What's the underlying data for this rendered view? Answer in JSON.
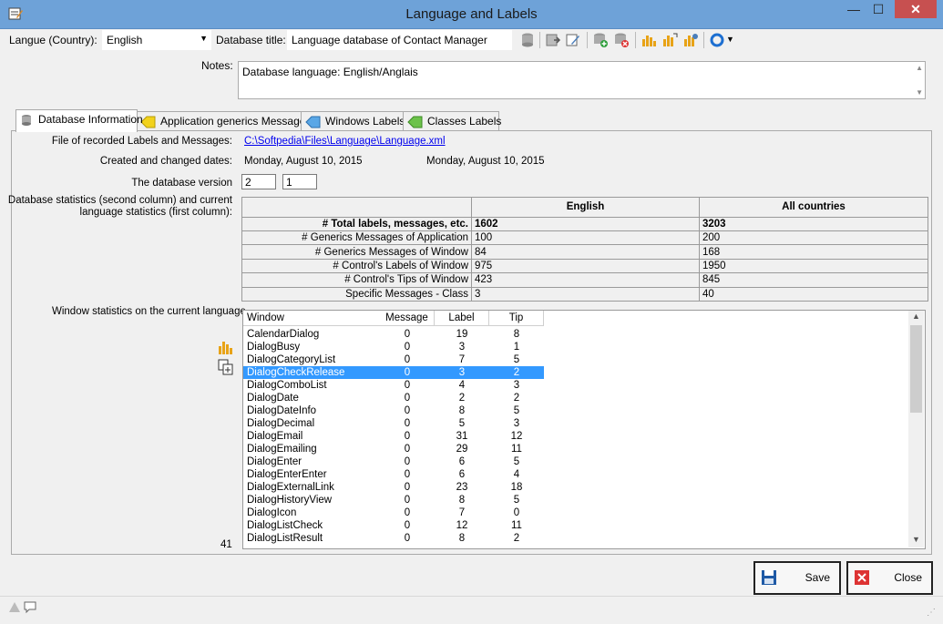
{
  "window": {
    "title": "Language and Labels",
    "min": "—",
    "max": "☐",
    "close": "✕"
  },
  "topbar": {
    "language_label": "Langue (Country):",
    "language_value": "English",
    "db_title_label": "Database title:",
    "db_title_value": "Language database of Contact Manager"
  },
  "notes": {
    "label": "Notes:",
    "value": "Database language: English/Anglais"
  },
  "tabs": [
    {
      "label": "Database Information"
    },
    {
      "label": "Application generics Messages"
    },
    {
      "label": "Windows Labels"
    },
    {
      "label": "Classes Labels"
    }
  ],
  "info": {
    "file_label": "File of recorded Labels and Messages:",
    "file_value": "C:\\Softpedia\\Files\\Language\\Language.xml",
    "dates_label": "Created and changed dates:",
    "created": "Monday, August 10, 2015",
    "changed": "Monday, August 10, 2015",
    "version_label": "The database version",
    "version_major": "2",
    "version_minor": "1",
    "stats_label_1": "Database statistics (second column) and current",
    "stats_label_2": "language statistics (first column):",
    "window_stats_label": "Window statistics on the current language",
    "window_count": "41"
  },
  "stats": {
    "headers": [
      "",
      "English",
      "All countries"
    ],
    "rows": [
      [
        "# Total labels, messages, etc.",
        "1602",
        "3203"
      ],
      [
        "# Generics Messages of Application",
        "100",
        "200"
      ],
      [
        "# Generics Messages of Window",
        "84",
        "168"
      ],
      [
        "# Control's Labels of Window",
        "975",
        "1950"
      ],
      [
        "# Control's Tips of Window",
        "423",
        "845"
      ],
      [
        "Specific Messages - Class",
        "3",
        "40"
      ]
    ]
  },
  "list": {
    "headers": [
      "Window",
      "Message",
      "Label",
      "Tip"
    ],
    "rows": [
      [
        "CalendarDialog",
        "0",
        "19",
        "8"
      ],
      [
        "DialogBusy",
        "0",
        "3",
        "1"
      ],
      [
        "DialogCategoryList",
        "0",
        "7",
        "5"
      ],
      [
        "DialogCheckRelease",
        "0",
        "3",
        "2"
      ],
      [
        "DialogComboList",
        "0",
        "4",
        "3"
      ],
      [
        "DialogDate",
        "0",
        "2",
        "2"
      ],
      [
        "DialogDateInfo",
        "0",
        "8",
        "5"
      ],
      [
        "DialogDecimal",
        "0",
        "5",
        "3"
      ],
      [
        "DialogEmail",
        "0",
        "31",
        "12"
      ],
      [
        "DialogEmailing",
        "0",
        "29",
        "11"
      ],
      [
        "DialogEnter",
        "0",
        "6",
        "5"
      ],
      [
        "DialogEnterEnter",
        "0",
        "6",
        "4"
      ],
      [
        "DialogExternalLink",
        "0",
        "23",
        "18"
      ],
      [
        "DialogHistoryView",
        "0",
        "8",
        "5"
      ],
      [
        "DialogIcon",
        "0",
        "7",
        "0"
      ],
      [
        "DialogListCheck",
        "0",
        "12",
        "11"
      ],
      [
        "DialogListResult",
        "0",
        "8",
        "2"
      ]
    ],
    "selected_index": 3
  },
  "buttons": {
    "save": "Save",
    "close": "Close"
  },
  "colors": {
    "titlebar": "#6ea2d8",
    "close_button": "#c75050",
    "selection": "#3399ff",
    "link": "#0000ee"
  }
}
